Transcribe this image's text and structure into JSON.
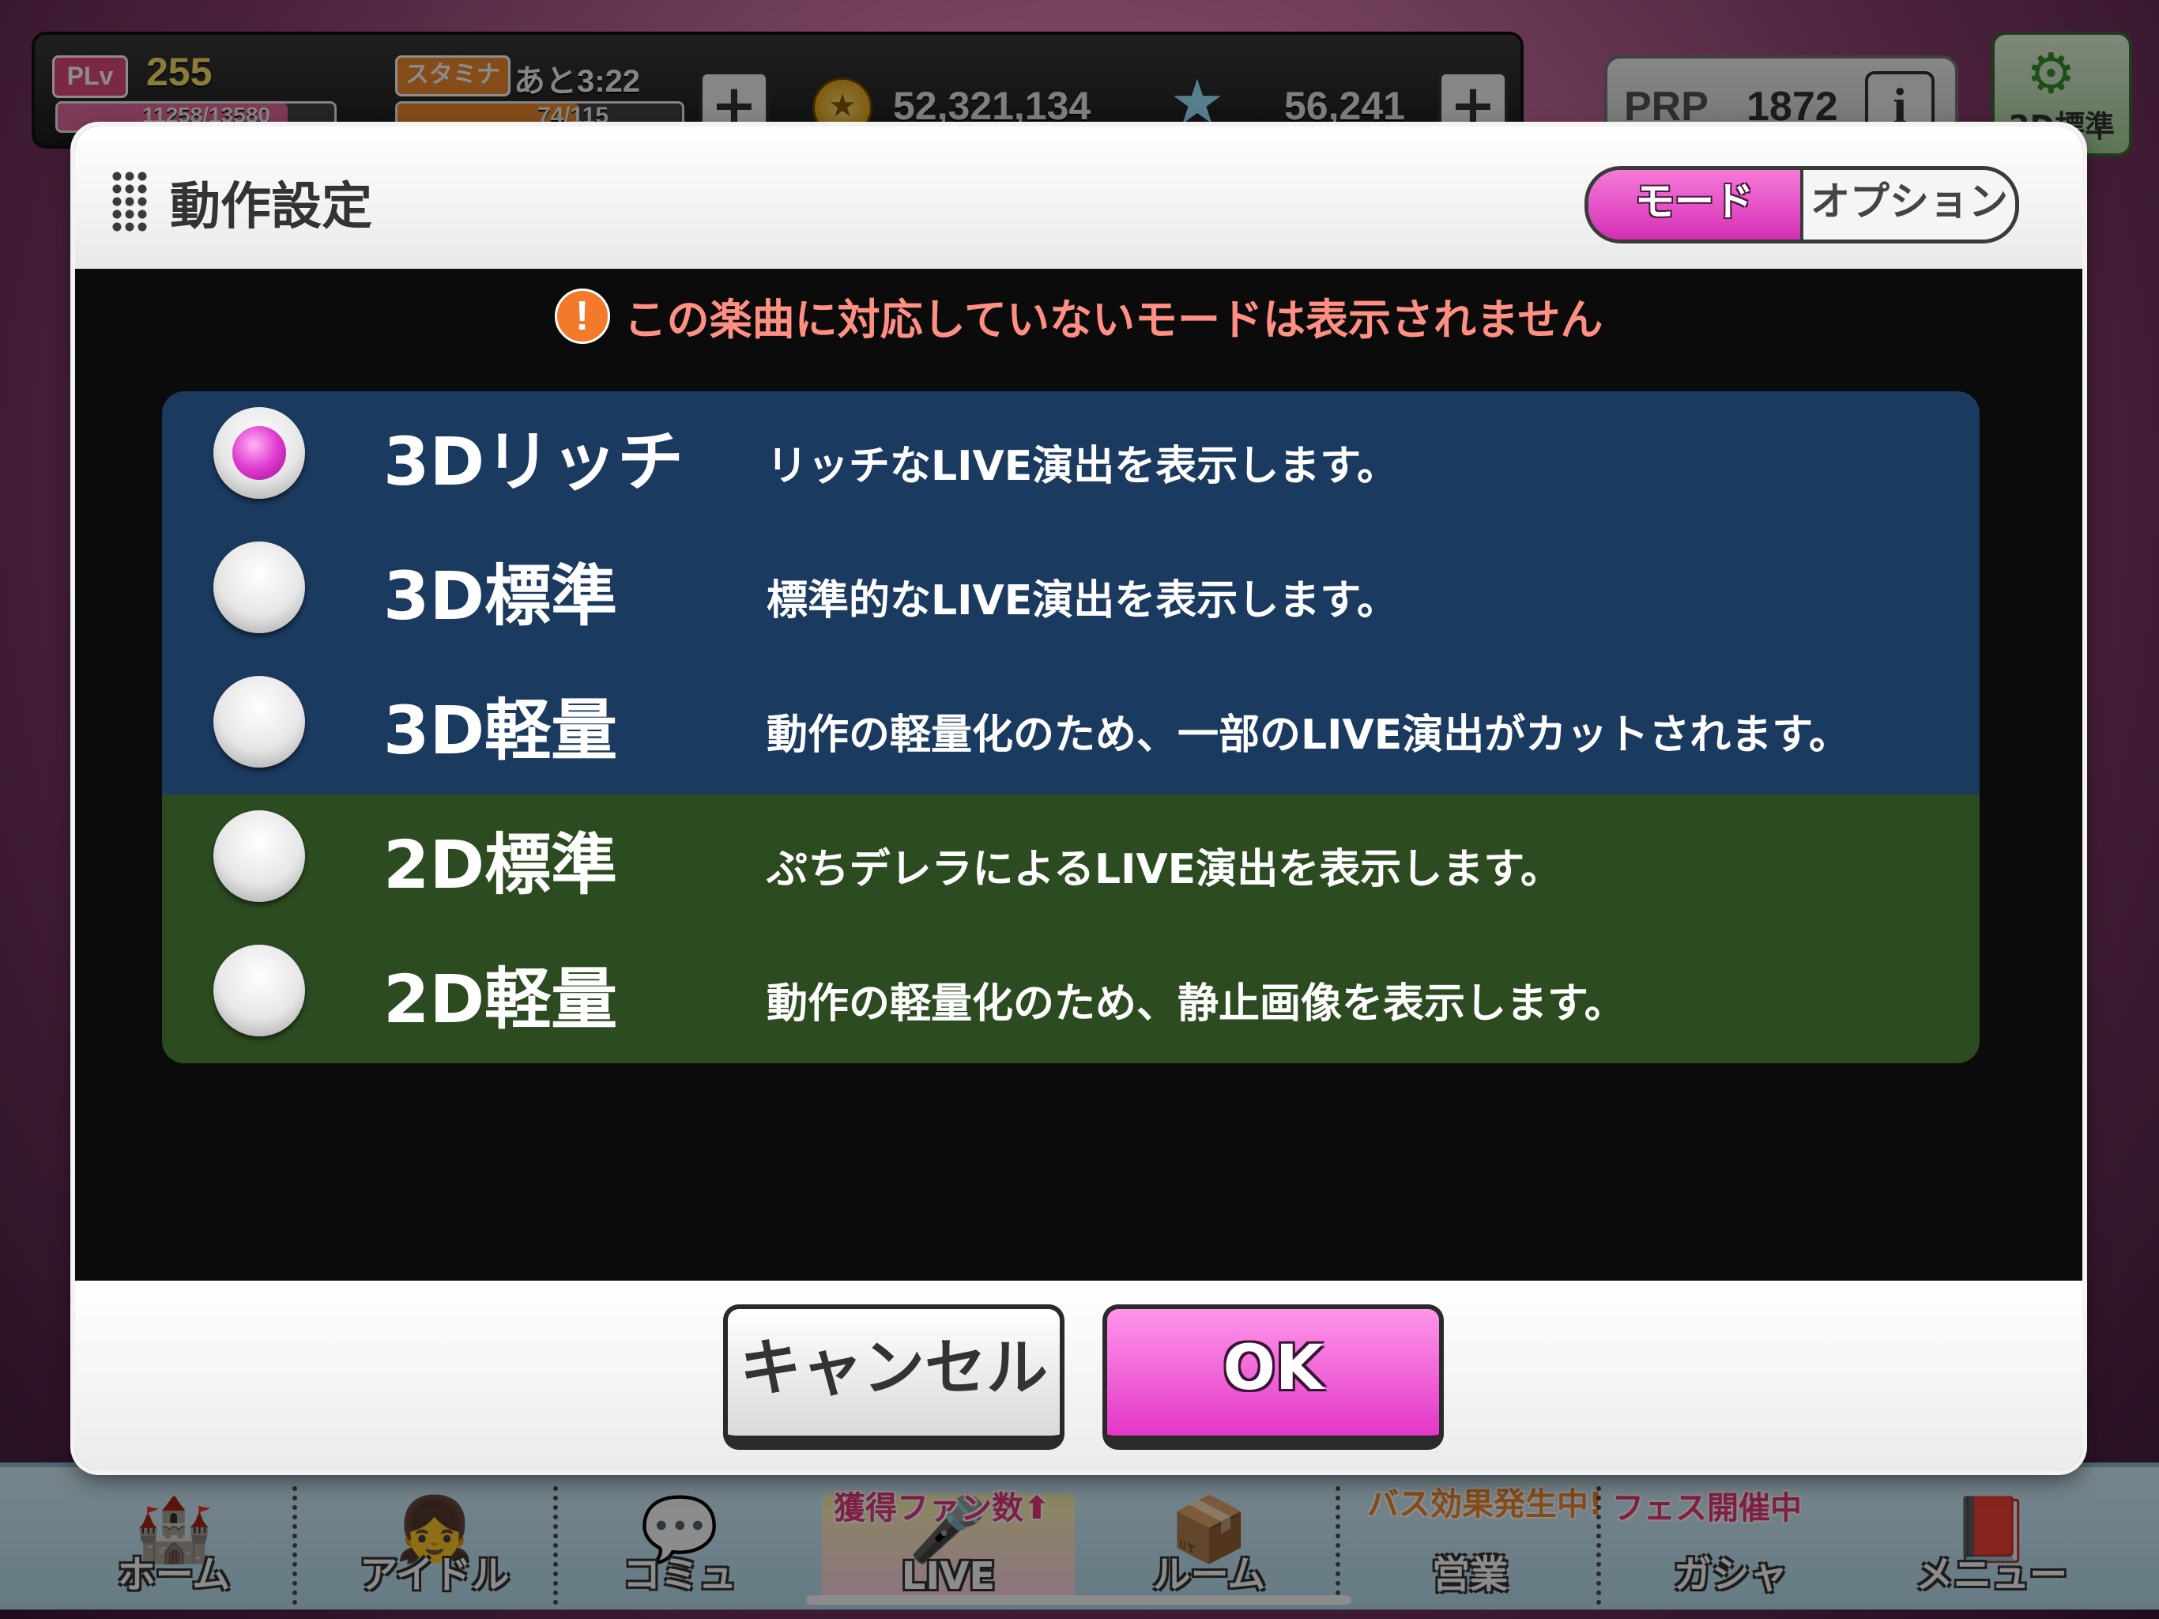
{
  "hud": {
    "plv_label": "PLv",
    "plv_value": "255",
    "exp_text": "11258/13580",
    "stamina_label": "スタミナ",
    "stamina_timer": "あと3:22",
    "stamina_value": "74/115",
    "money": "52,321,134",
    "jewels": "56,241",
    "prp_label": "PRP",
    "prp_value": "1872",
    "info_glyph": "i",
    "mode_button_label": "2D標準"
  },
  "dialog": {
    "title": "動作設定",
    "tabs": [
      {
        "label": "モード",
        "active": true
      },
      {
        "label": "オプション",
        "active": false
      }
    ],
    "warning_icon": "!",
    "warning_text": "この楽曲に対応していないモードは表示されません",
    "modes": [
      {
        "name": "3Dリッチ",
        "desc": "リッチなLIVE演出を表示します。",
        "selected": true,
        "group": "3D"
      },
      {
        "name": "3D標準",
        "desc": "標準的なLIVE演出を表示します。",
        "selected": false,
        "group": "3D"
      },
      {
        "name": "3D軽量",
        "desc": "動作の軽量化のため、一部のLIVE演出がカットされます。",
        "selected": false,
        "group": "3D"
      },
      {
        "name": "2D標準",
        "desc": "ぷちデレラによるLIVE演出を表示します。",
        "selected": false,
        "group": "2D"
      },
      {
        "name": "2D軽量",
        "desc": "動作の軽量化のため、静止画像を表示します。",
        "selected": false,
        "group": "2D"
      }
    ],
    "cancel_label": "キャンセル",
    "ok_label": "OK"
  },
  "nav": {
    "items": [
      {
        "label": "ホーム",
        "icon": "castle-icon"
      },
      {
        "label": "アイドル",
        "icon": "idol-icon"
      },
      {
        "label": "コミュ",
        "icon": "speech-bubble-icon"
      },
      {
        "label": "LIVE",
        "icon": "live-icon",
        "badge": "獲得ファン数⬆"
      },
      {
        "label": "ルーム",
        "icon": "room-icon"
      },
      {
        "label": "営業",
        "icon": "business-icon",
        "badge": "バス効果発生中!"
      },
      {
        "label": "ガシャ",
        "icon": "gacha-icon",
        "badge": "フェス開催中"
      },
      {
        "label": "メニュー",
        "icon": "menu-book-icon"
      }
    ]
  },
  "colors": {
    "accent_pink": "#e03bd0",
    "mode_3d_bg": "#1b3a5f",
    "mode_2d_bg": "#2c4b20",
    "warning": "#ff8f83"
  }
}
